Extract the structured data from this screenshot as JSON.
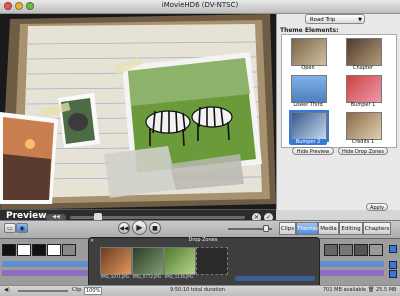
{
  "window": {
    "title": "iMovieHD6 (DV-NTSC)"
  },
  "preview": {
    "label": "Preview",
    "rewind_icon": "rewind-icon",
    "close_icon": "close-icon",
    "apply_icon": "checkmark-icon"
  },
  "themes": {
    "selected_theme": "Road Trip",
    "elements_label": "Theme Elements:",
    "tiles": [
      {
        "label": "Open"
      },
      {
        "label": "Chapter"
      },
      {
        "label": "Lower Third"
      },
      {
        "label": "Bumper 1"
      },
      {
        "label": "Bumper 2",
        "selected": true
      },
      {
        "label": "Credits 1"
      }
    ],
    "hide_preview_label": "Hide Preview",
    "hide_drop_zones_label": "Hide Drop Zones",
    "apply_label": "Apply"
  },
  "toolbar": {
    "tabs": [
      {
        "label": "Clips"
      },
      {
        "label": "Themes",
        "active": true
      },
      {
        "label": "Media"
      },
      {
        "label": "Editing"
      },
      {
        "label": "Chapters"
      }
    ]
  },
  "drop_zones": {
    "header": "Drop Zones",
    "items": [
      {
        "label": "IMG_1071.JPG"
      },
      {
        "label": "IMG_0772.JPG"
      },
      {
        "label": "IMG_1116.JPG"
      }
    ]
  },
  "status": {
    "clip_label": "Clip",
    "zoom": "100%",
    "duration_text": "9:50:10 total duration",
    "disk_space": "701 MB available",
    "size_readout": "25.5 MB"
  }
}
